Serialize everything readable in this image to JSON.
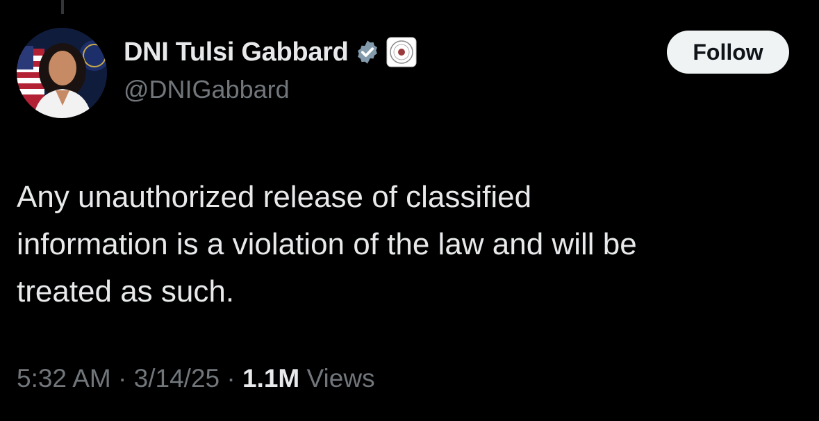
{
  "tweet": {
    "author": {
      "display_name": "DNI Tulsi Gabbard",
      "handle": "@DNIGabbard",
      "avatar": "profile-photo",
      "badges": [
        "verified-badge-icon",
        "government-seal-icon"
      ]
    },
    "follow_label": "Follow",
    "text": "Any unauthorized release of classified\ninformation is a violation of the law and will be\ntreated as such.",
    "time": "5:32 AM",
    "separator": " · ",
    "date": "3/14/25",
    "views_count": "1.1M",
    "views_label": " Views"
  },
  "colors": {
    "background": "#000000",
    "primary_text": "#e7e9ea",
    "secondary_text": "#71767b",
    "verified_badge": "#829aab",
    "follow_button_bg": "#eff3f4",
    "follow_button_text": "#0f1419"
  }
}
